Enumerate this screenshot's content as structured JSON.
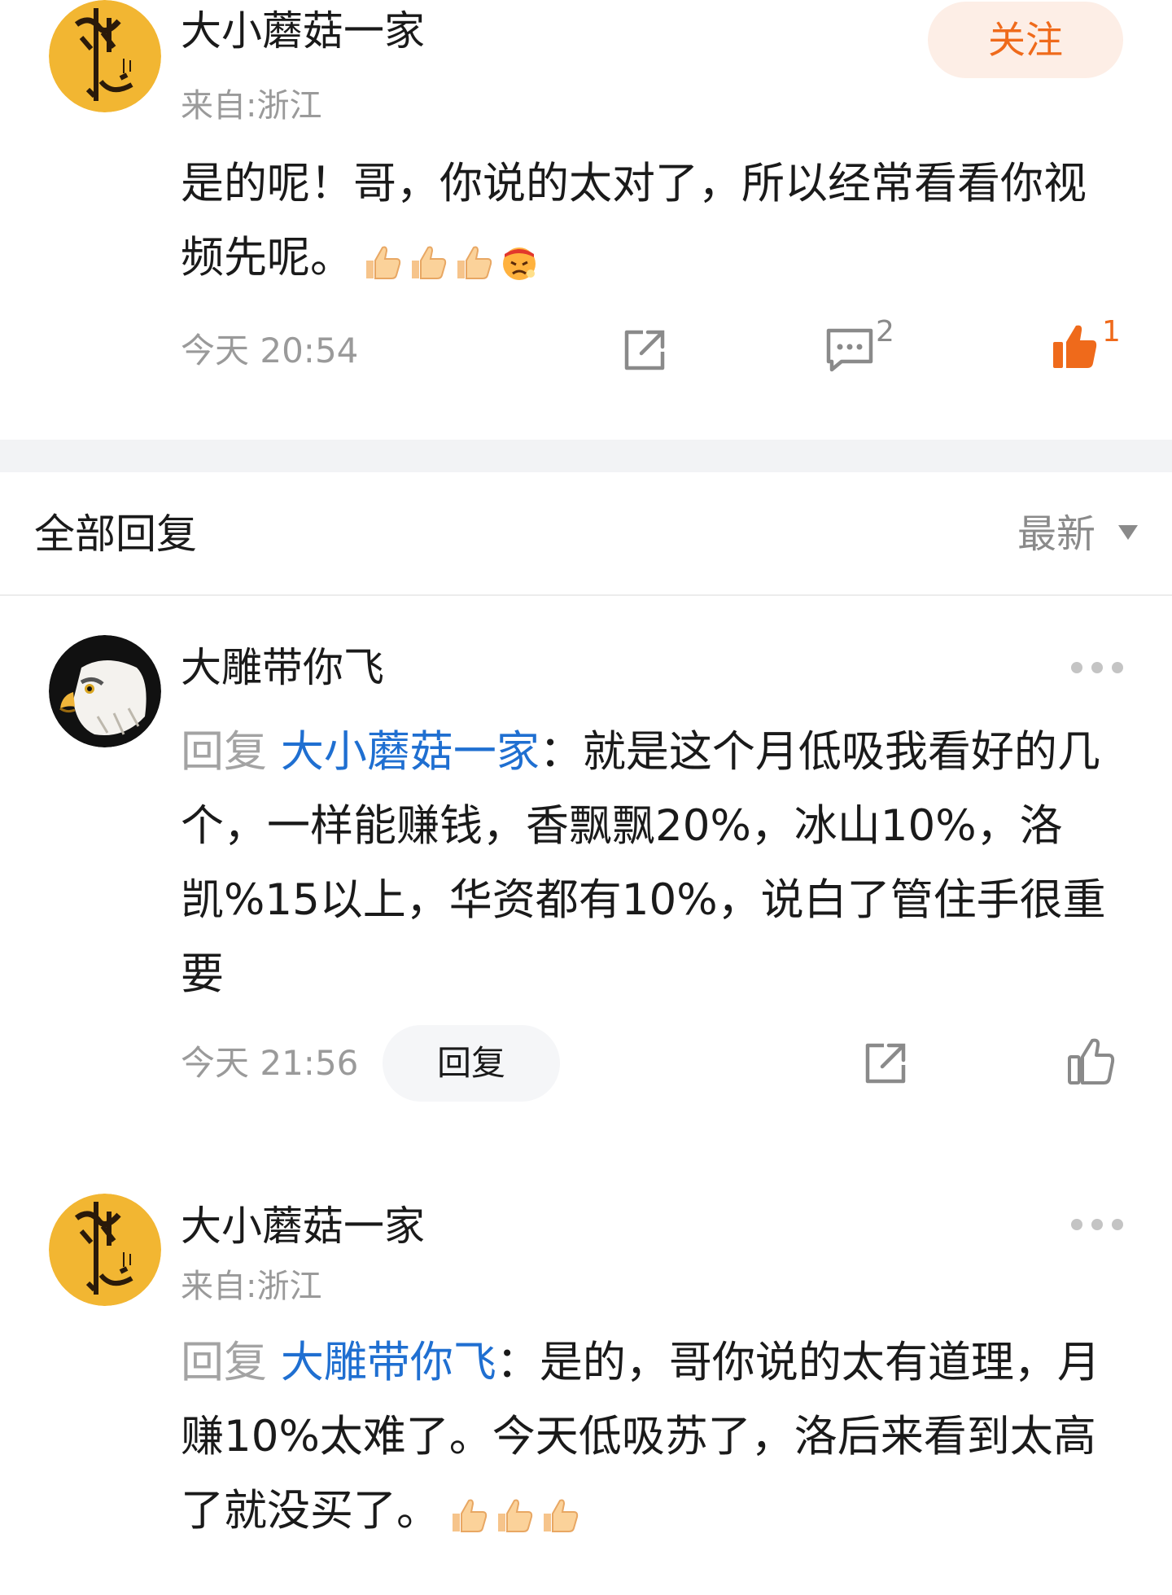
{
  "original_comment": {
    "username": "大小蘑菇一家",
    "location": "来自:浙江",
    "follow_label": "关注",
    "text": "是的呢！哥，你说的太对了，所以经常看看你视频先呢。",
    "emoji": [
      "thumbs-up",
      "thumbs-up",
      "thumbs-up",
      "angry-face"
    ],
    "time": "今天 20:54",
    "reply_count": "2",
    "like_count": "1"
  },
  "replies_header": {
    "title": "全部回复",
    "sort_label": "最新"
  },
  "replies": [
    {
      "username": "大雕带你飞",
      "reply_prefix": "回复",
      "mention": "大小蘑菇一家",
      "text": "：就是这个月低吸我看好的几个，一样能赚钱，香飘飘20%，冰山10%，洛凯%15以上，华资都有10%，说白了管住手很重要",
      "time": "今天 21:56",
      "reply_label": "回复"
    },
    {
      "username": "大小蘑菇一家",
      "location": "来自:浙江",
      "reply_prefix": "回复",
      "mention": "大雕带你飞",
      "text": "：是的，哥你说的太有道理，月赚10%太难了。今天低吸苏了，洛后来看到太高了就没买了。",
      "emoji": [
        "thumbs-up",
        "thumbs-up",
        "thumbs-up"
      ]
    }
  ],
  "colors": {
    "accent_orange": "#ef6a1b",
    "mention_blue": "#1f6fd1",
    "muted_gray": "#9a9a9a"
  }
}
